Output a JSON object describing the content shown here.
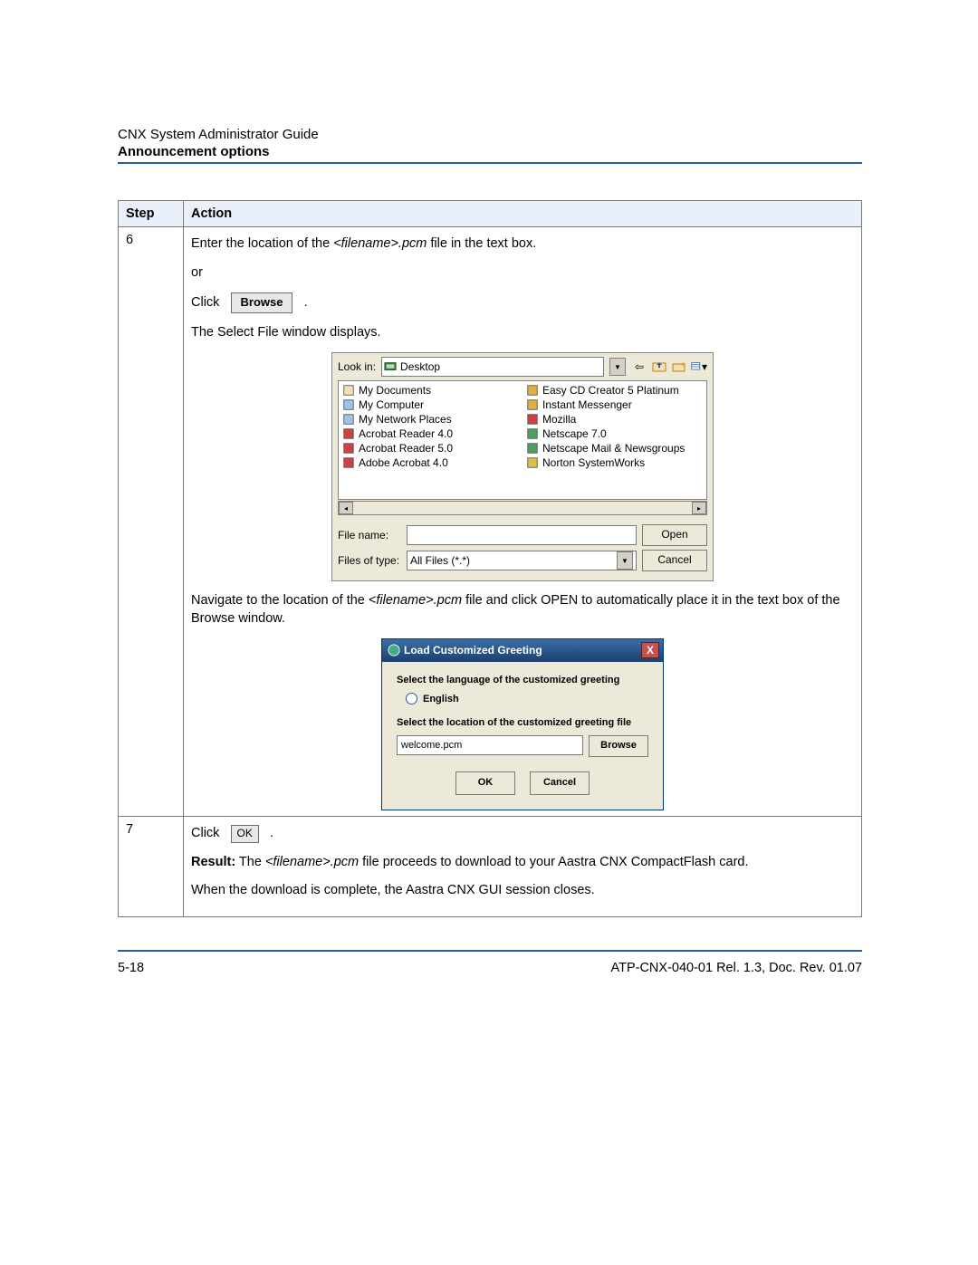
{
  "header": {
    "doc_title": "CNX System Administrator Guide",
    "section_title": "Announcement options"
  },
  "table": {
    "headers": {
      "step": "Step",
      "action": "Action"
    },
    "rows": [
      {
        "step": "6",
        "action": {
          "line1_prefix": "Enter the location of the ",
          "line1_italic": "<filename>.pcm",
          "line1_suffix": " file in the text box.",
          "or": "or",
          "click": "Click",
          "browse_btn": "Browse",
          "period": ".",
          "select_displays": "The Select File window displays.",
          "nav_prefix": "Navigate to the location of the ",
          "nav_italic": "<filename>.pcm",
          "nav_suffix": " file and click OPEN to automatically place it in the text box of the Browse window."
        }
      },
      {
        "step": "7",
        "action": {
          "click": "Click",
          "ok_btn": "OK",
          "period": ".",
          "result_label": "Result:",
          "result_prefix": " The ",
          "result_italic": "<filename>.pcm",
          "result_suffix": " file proceeds to download to your Aastra CNX CompactFlash card.",
          "closing": "When the download is complete, the Aastra CNX GUI session closes."
        }
      }
    ]
  },
  "file_dialog": {
    "look_in_label": "Look in:",
    "look_in_value": "Desktop",
    "file_name_label": "File name:",
    "file_name_value": "",
    "files_of_type_label": "Files of type:",
    "files_of_type_value": "All Files (*.*)",
    "open_btn": "Open",
    "cancel_btn": "Cancel",
    "left_items": [
      "My Documents",
      "My Computer",
      "My Network Places",
      "Acrobat Reader 4.0",
      "Acrobat Reader 5.0",
      "Adobe Acrobat 4.0"
    ],
    "right_items": [
      "Easy CD Creator 5 Platinum",
      "Instant Messenger",
      "Mozilla",
      "Netscape 7.0",
      "Netscape Mail & Newsgroups",
      "Norton SystemWorks"
    ]
  },
  "greeting_dialog": {
    "title": "Load Customized Greeting",
    "close_x": "X",
    "lang_header": "Select the language of the customized greeting",
    "radio_english": "English",
    "loc_header": "Select the location of the customized greeting file",
    "file_value": "welcome.pcm",
    "browse_btn": "Browse",
    "ok_btn": "OK",
    "cancel_btn": "Cancel"
  },
  "footer": {
    "page": "5-18",
    "doc_id": "ATP-CNX-040-01 Rel. 1.3, Doc. Rev. 01.07"
  }
}
